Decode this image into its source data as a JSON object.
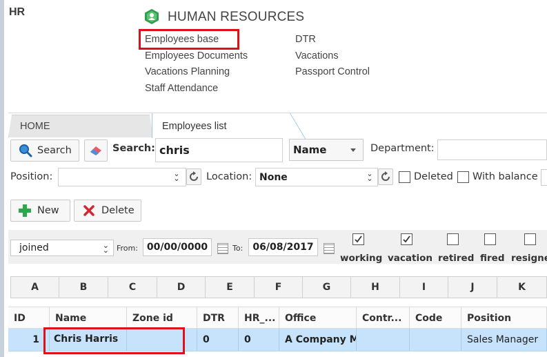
{
  "app": {
    "section_label": "HR"
  },
  "module": {
    "title": "HUMAN RESOURCES",
    "links_col1": [
      "Employees base",
      "Employees Documents",
      "Vacations Planning",
      "Staff Attendance"
    ],
    "links_col2": [
      "DTR",
      "Vacations",
      "Passport Control"
    ]
  },
  "tabs": [
    {
      "label": "HOME",
      "active": false
    },
    {
      "label": "Employees list",
      "active": true
    }
  ],
  "toolbar": {
    "search_button": "Search",
    "search_label": "Search:",
    "search_value": "chris",
    "sort_field": "Name",
    "department_label": "Department:",
    "department_value": "",
    "position_label": "Position:",
    "position_value": "",
    "location_label": "Location:",
    "location_value": "None",
    "deleted_label": "Deleted",
    "deleted_checked": false,
    "with_balance_label": "With balance",
    "with_balance_checked": false,
    "new_button": "New",
    "delete_button": "Delete"
  },
  "date_filter": {
    "field": "joined",
    "from_label": "From:",
    "from_value": "00/00/0000",
    "to_label": "To:",
    "to_value": "06/08/2017"
  },
  "status_filters": [
    {
      "label": "working",
      "checked": true
    },
    {
      "label": "vacation",
      "checked": true
    },
    {
      "label": "retired",
      "checked": false
    },
    {
      "label": "fired",
      "checked": false
    },
    {
      "label": "resigne",
      "checked": false
    }
  ],
  "sheet_columns": [
    "A",
    "B",
    "C",
    "D",
    "E",
    "F",
    "G",
    "H",
    "I",
    "J",
    "K"
  ],
  "table": {
    "headers": [
      "ID",
      "Name",
      "Zone id",
      "DTR",
      "HR_...",
      "Office",
      "Contr...",
      "Code",
      "Position"
    ],
    "rows": [
      [
        "1",
        "Chris Harris",
        "",
        "0",
        "0",
        "A Company M",
        "",
        "",
        "Sales Manager"
      ]
    ]
  },
  "colors": {
    "highlight": "#e0101a",
    "selected_row": "#c6e3fb",
    "brand_icon": "#2e9e4f"
  }
}
